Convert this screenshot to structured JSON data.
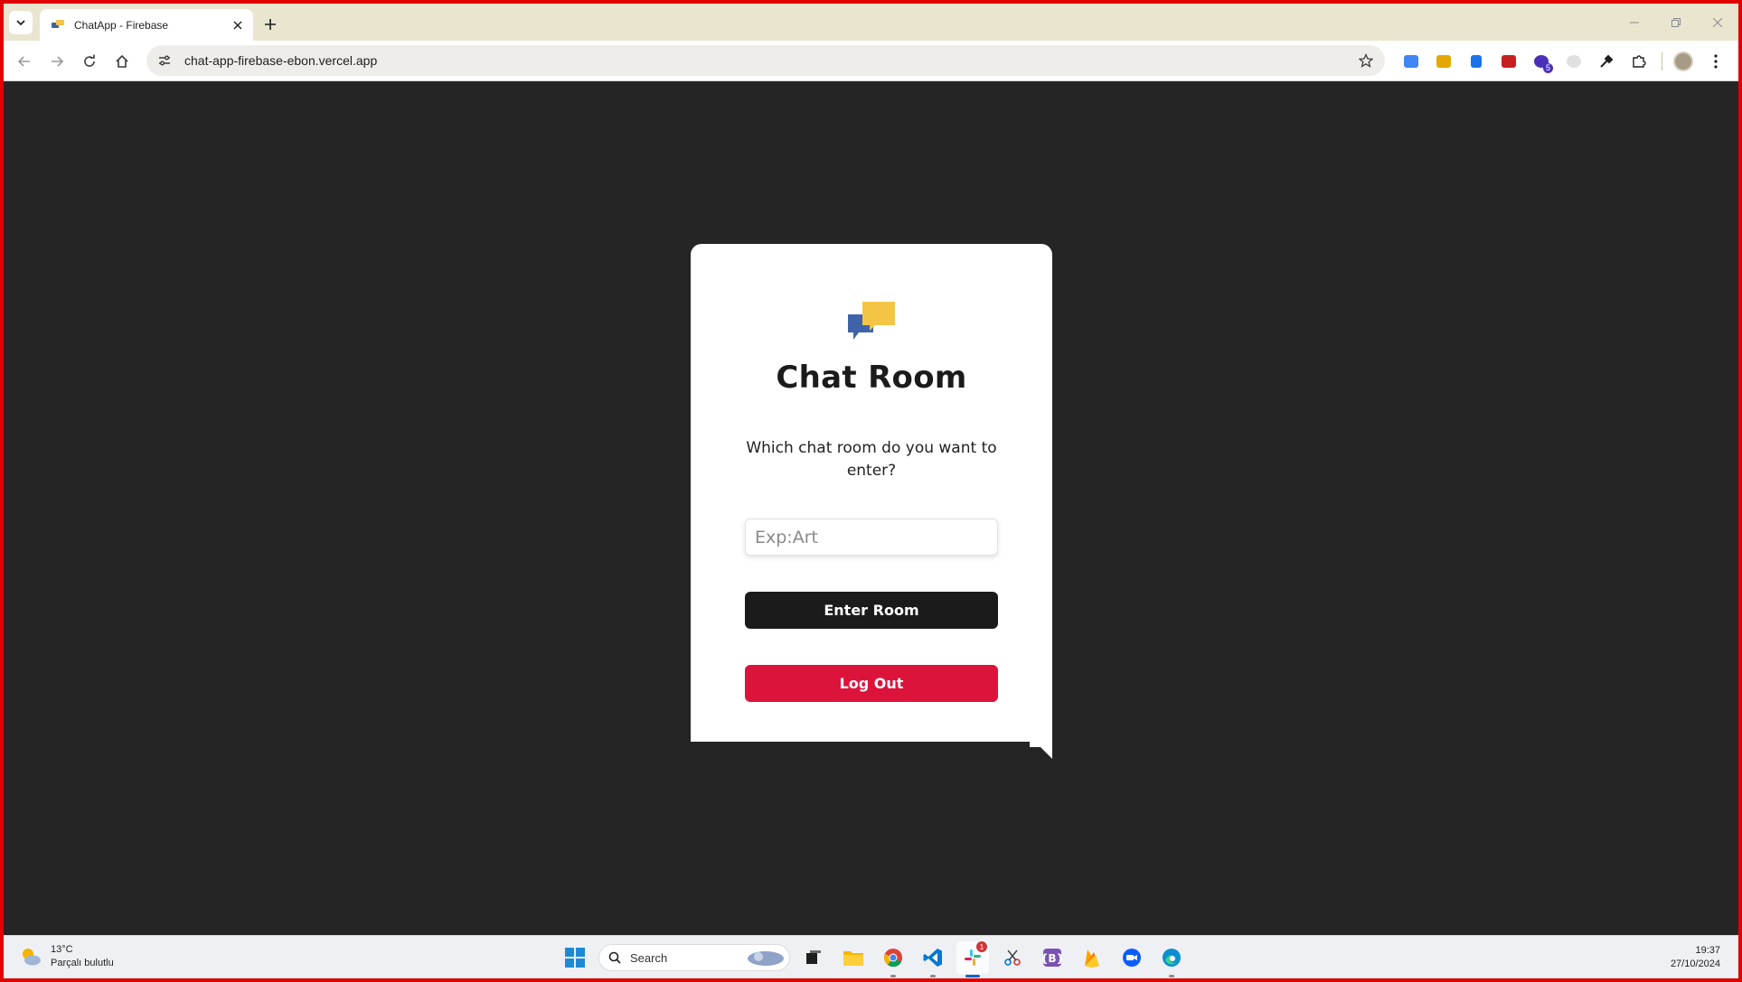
{
  "browser": {
    "tab": {
      "title": "ChatApp - Firebase"
    },
    "address": {
      "url": "chat-app-firebase-ebon.vercel.app"
    },
    "extensions": [
      {
        "name": "google-translate-icon",
        "color": "#4285f4"
      },
      {
        "name": "extension-yellow-icon",
        "color": "#e5a800"
      },
      {
        "name": "reader-icon",
        "color": "#1a73e8"
      },
      {
        "name": "calendar-icon",
        "color": "#c5221f"
      },
      {
        "name": "extension-purple-icon",
        "color": "#4a30b8",
        "badge": "5"
      },
      {
        "name": "extension-gray-icon",
        "color": "#cfcfcf"
      },
      {
        "name": "eyedropper-icon",
        "color": "#1f1f1f"
      },
      {
        "name": "puzzle-icon",
        "color": "#1f1f1f"
      }
    ]
  },
  "page": {
    "title": "Chat Room",
    "question": "Which chat room do you want to enter?",
    "room_input": {
      "placeholder": "Exp:Art",
      "value": ""
    },
    "enter_button": "Enter Room",
    "logout_button": "Log Out",
    "colors": {
      "background": "#252525",
      "card": "#ffffff",
      "enter": "#1b1b1b",
      "logout": "#dc143c",
      "bubble_blue": "#3e63a8",
      "bubble_yellow": "#f4c545"
    }
  },
  "taskbar": {
    "weather": {
      "temp": "13°C",
      "condition": "Parçalı bulutlu"
    },
    "search_label": "Search",
    "slack_badge": "1",
    "clock": {
      "time": "19:37",
      "date": "27/10/2024"
    }
  }
}
